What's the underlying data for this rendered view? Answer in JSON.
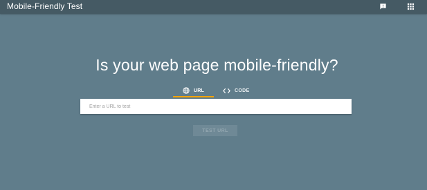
{
  "header": {
    "app_title": "Mobile-Friendly Test",
    "feedback_icon": "feedback-icon",
    "apps_icon": "apps-grid-icon"
  },
  "main": {
    "headline": "Is your web page mobile-friendly?",
    "tabs": [
      {
        "label": "URL",
        "icon": "globe-icon",
        "selected": true
      },
      {
        "label": "CODE",
        "icon": "code-brackets-icon",
        "selected": false
      }
    ],
    "url_input": {
      "placeholder": "Enter a URL to test",
      "value": ""
    },
    "test_button": {
      "label": "TEST URL",
      "enabled": false
    }
  },
  "colors": {
    "background": "#607d8b",
    "header": "#455a64",
    "tab_indicator": "#f4a300"
  }
}
